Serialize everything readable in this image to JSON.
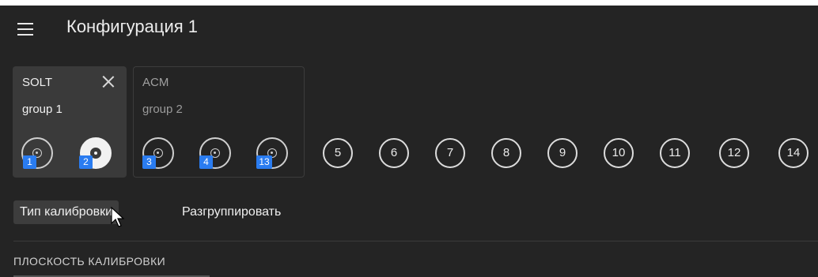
{
  "header": {
    "title": "Конфигурация 1"
  },
  "groups": [
    {
      "type": "SOLT",
      "name": "group 1",
      "ports": [
        {
          "badge": "1",
          "style": "outline"
        },
        {
          "badge": "2",
          "style": "filled"
        }
      ],
      "close_icon": "close-icon"
    },
    {
      "type": "ACM",
      "name": "group 2",
      "ports": [
        {
          "badge": "3"
        },
        {
          "badge": "4"
        },
        {
          "badge": "13"
        }
      ]
    }
  ],
  "ports": [
    "5",
    "6",
    "7",
    "8",
    "9",
    "10",
    "11",
    "12",
    "14"
  ],
  "toolbar": {
    "calibration_type": "Тип калибровки",
    "ungroup": "Разгруппировать"
  },
  "section": {
    "title": "ПЛОСКОСТЬ КАЛИБРОВКИ"
  },
  "colors": {
    "background": "#242424",
    "panel": "#3a3a3a",
    "badge": "#2a7cf0"
  }
}
